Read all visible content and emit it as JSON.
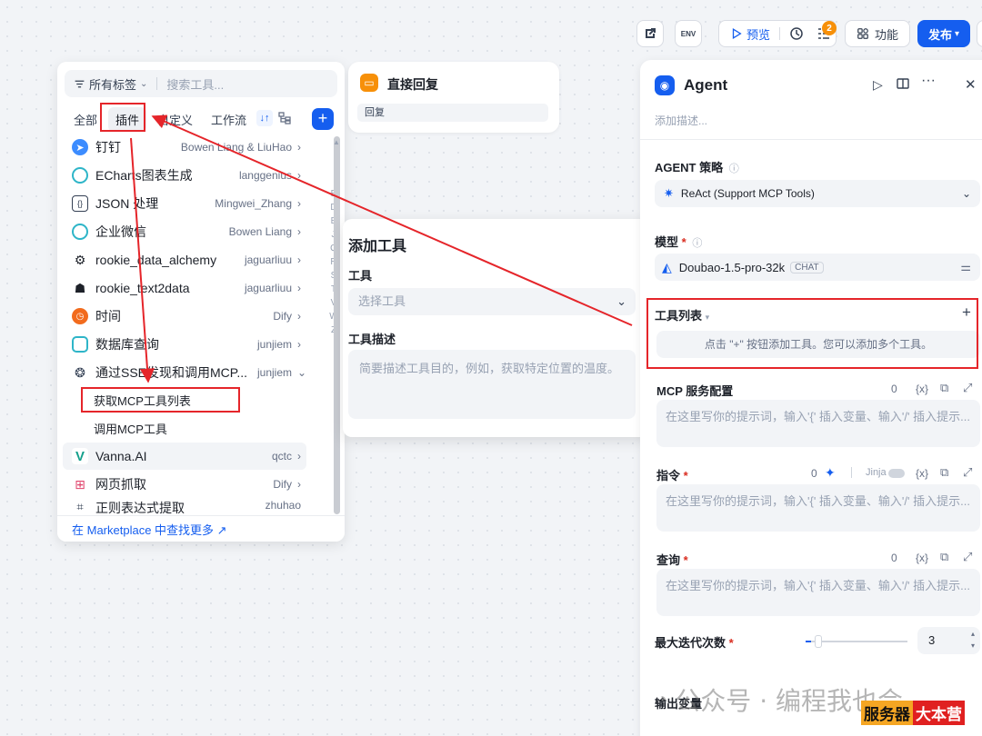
{
  "toolbar": {
    "preview_label": "预览",
    "features_label": "功能",
    "publish_label": "发布",
    "badge_count": "2"
  },
  "picker": {
    "tag_filter": "所有标签",
    "search_placeholder": "搜索工具...",
    "tabs": [
      "全部",
      "插件",
      "自定义",
      "工作流"
    ],
    "items": [
      {
        "name": "钉钉",
        "author": "Bowen Liang & LiuHao"
      },
      {
        "name": "ECharts图表生成",
        "author": "langgenius"
      },
      {
        "name": "JSON 处理",
        "author": "Mingwei_Zhang"
      },
      {
        "name": "企业微信",
        "author": "Bowen Liang"
      },
      {
        "name": "rookie_data_alchemy",
        "author": "jaguarliuu"
      },
      {
        "name": "rookie_text2data",
        "author": "jaguarliuu"
      },
      {
        "name": "时间",
        "author": "Dify"
      },
      {
        "name": "数据库查询",
        "author": "junjiem"
      },
      {
        "name": "通过SSE发现和调用MCP...",
        "author": "junjiem"
      },
      {
        "name": "Vanna.AI",
        "author": "qctc"
      },
      {
        "name": "网页抓取",
        "author": "Dify"
      },
      {
        "name": "正则表达式提取",
        "author": "zhuhao"
      }
    ],
    "sub_items": [
      "获取MCP工具列表",
      "调用MCP工具"
    ],
    "index_letters": [
      "B",
      "D",
      "E",
      "J",
      "Q",
      "R",
      "S",
      "T",
      "V",
      "W",
      "Z"
    ],
    "marketplace_link": "在 Marketplace 中查找更多 ↗"
  },
  "reply_node": {
    "title": "直接回复",
    "chip": "回复"
  },
  "add_tool": {
    "title": "添加工具",
    "tool_label": "工具",
    "tool_placeholder": "选择工具",
    "desc_label": "工具描述",
    "desc_placeholder": "简要描述工具目的，例如，获取特定位置的温度。"
  },
  "agent": {
    "title": "Agent",
    "desc_placeholder": "添加描述...",
    "strategy_label": "AGENT 策略",
    "strategy_value": "ReAct (Support MCP Tools)",
    "model_label": "模型",
    "model_value": "Doubao-1.5-pro-32k",
    "model_tag": "CHAT",
    "tool_list_label": "工具列表",
    "tool_list_hint": "点击 \"+\" 按钮添加工具。您可以添加多个工具。",
    "mcp_label": "MCP 服务配置",
    "mcp_count": "0",
    "prompt_placeholder": "在这里写你的提示词，输入'{' 插入变量、输入'/' 插入提示...",
    "instruction_label": "指令",
    "instruction_count": "0",
    "jinja_label": "Jinja",
    "query_label": "查询",
    "query_count": "0",
    "max_iter_label": "最大迭代次数",
    "max_iter_value": "3",
    "max_iter_slider_fraction": 0.05,
    "output_label": "输出变量",
    "var_icon_text": "{x}"
  },
  "watermark": {
    "text": "公众号 · 编程我也会",
    "badge_a": "服务器",
    "badge_b": "大本营"
  }
}
